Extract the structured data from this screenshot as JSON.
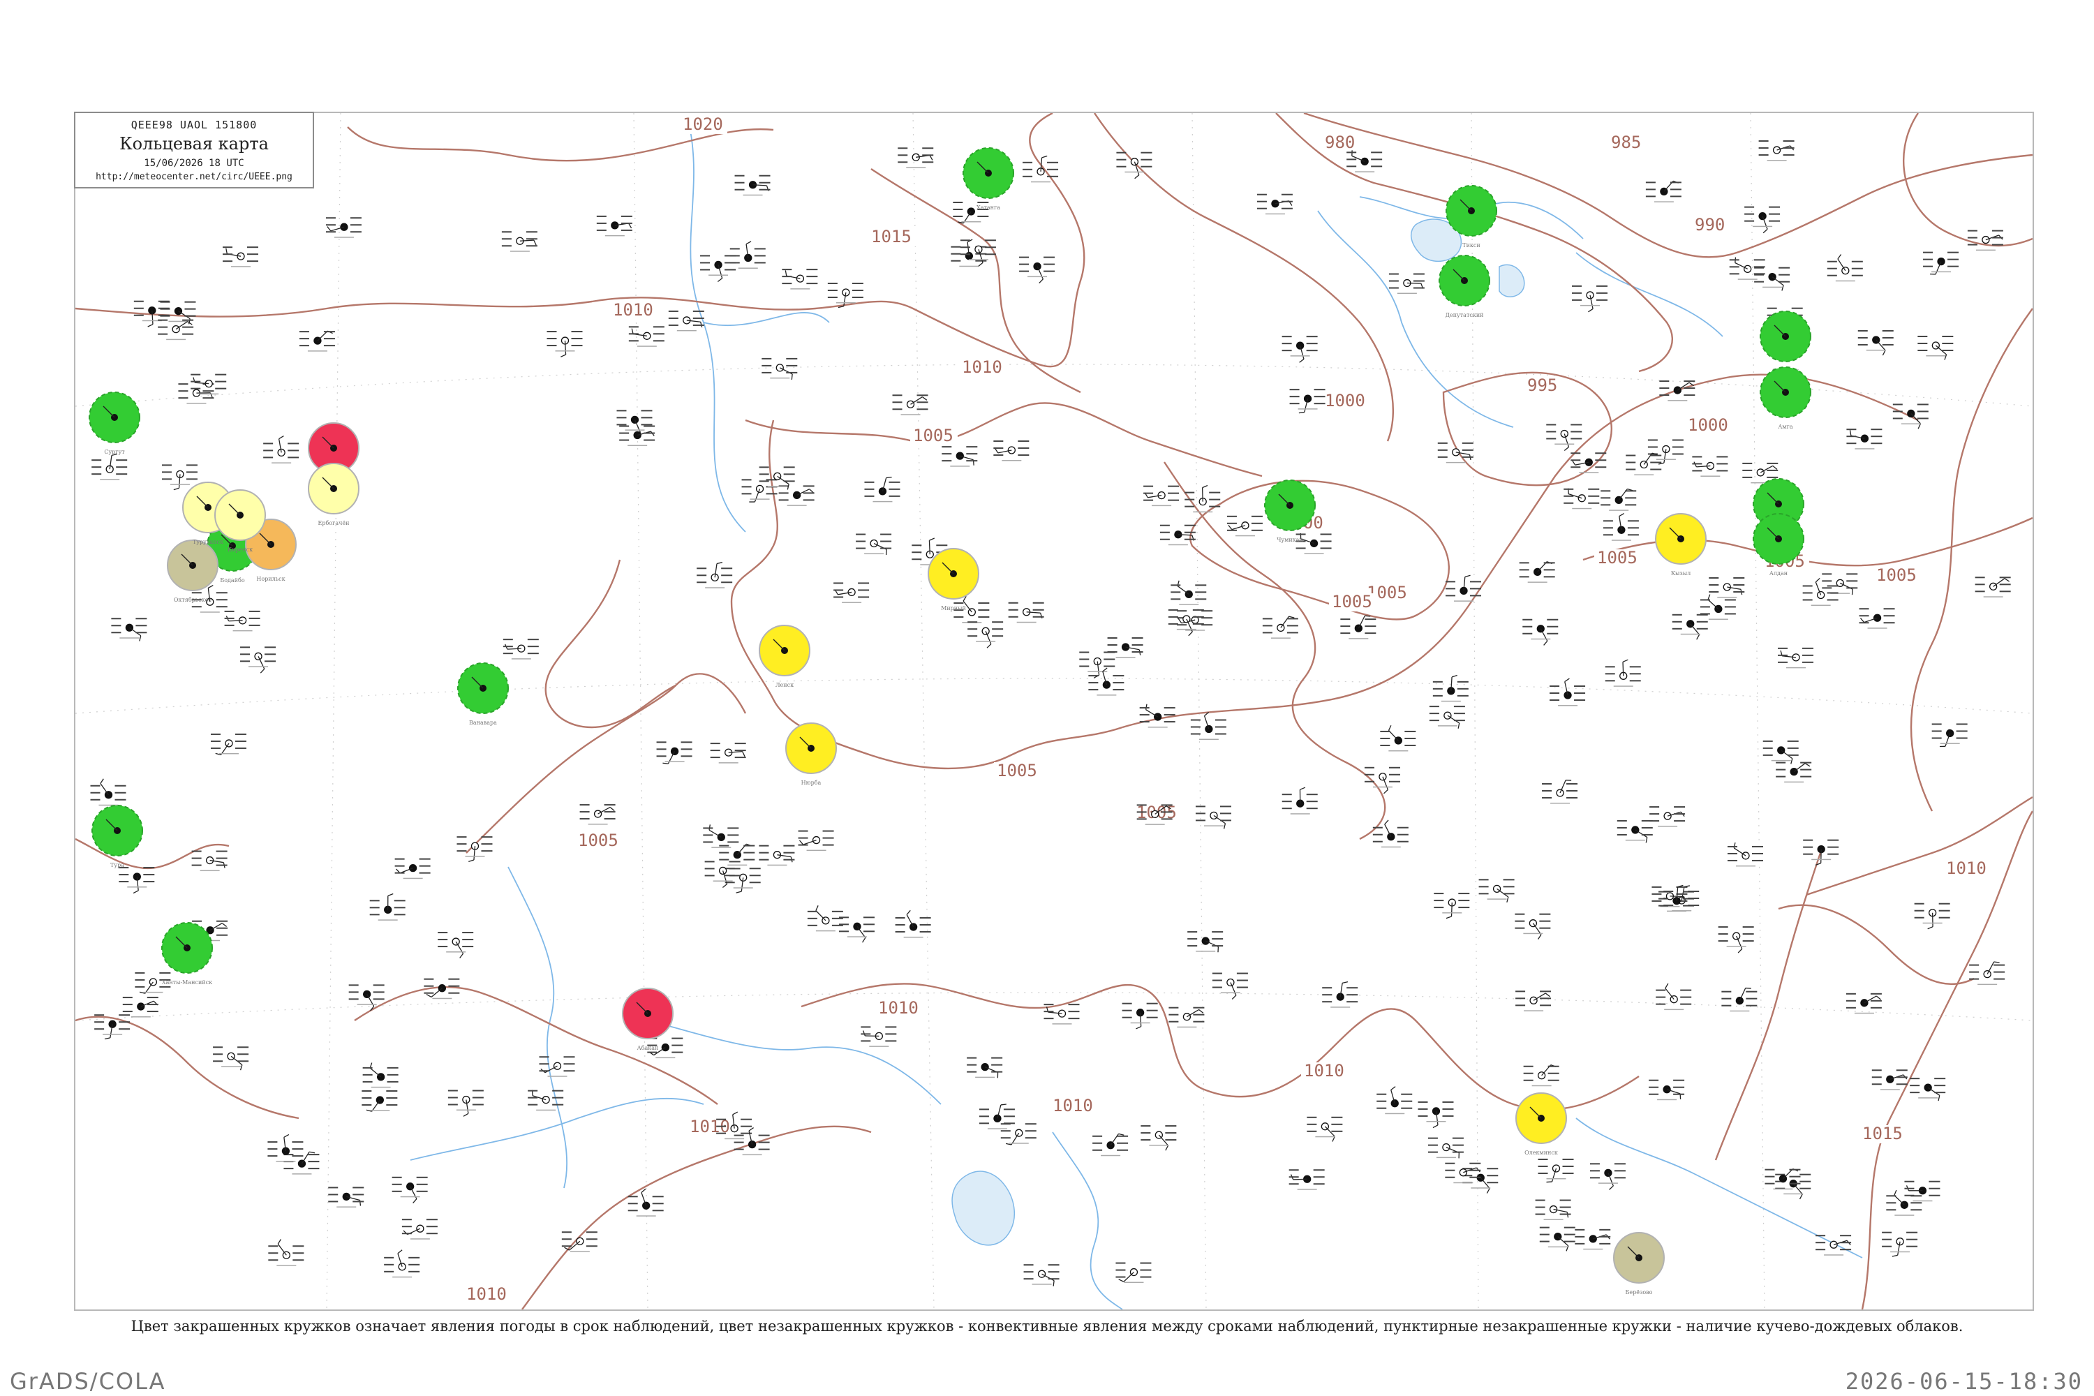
{
  "map_header": {
    "code": "QEEE98  UAOL  151800",
    "title": "Кольцевая карта",
    "datetime": "15/06/2026 18 UTC",
    "url": "http://meteocenter.net/circ/UEEE.png"
  },
  "isobar_labels": [
    {
      "text": "1020"
    },
    {
      "text": "1015"
    },
    {
      "text": "1010"
    },
    {
      "text": "1010"
    },
    {
      "text": "1005"
    },
    {
      "text": "1005"
    },
    {
      "text": "1005"
    },
    {
      "text": "1005"
    },
    {
      "text": "1005"
    },
    {
      "text": "1005"
    },
    {
      "text": "1000"
    },
    {
      "text": "1000"
    },
    {
      "text": "1000"
    },
    {
      "text": "995"
    },
    {
      "text": "990"
    },
    {
      "text": "985"
    },
    {
      "text": "980"
    },
    {
      "text": "1005"
    },
    {
      "text": "1010"
    },
    {
      "text": "1010"
    },
    {
      "text": "1010"
    },
    {
      "text": "1010"
    },
    {
      "text": "1015"
    },
    {
      "text": "1010"
    },
    {
      "text": "1010"
    },
    {
      "text": "1005"
    },
    {
      "text": "1005"
    }
  ],
  "marked_stations": [
    {
      "color": "#33cc33",
      "dashed": true,
      "label": "Хатанга"
    },
    {
      "color": "#33cc33",
      "dashed": true,
      "label": "Тикси"
    },
    {
      "color": "#33cc33",
      "dashed": true,
      "label": "Депутатский"
    },
    {
      "color": "#33cc33",
      "dashed": true,
      "label": "Оймякон"
    },
    {
      "color": "#33cc33",
      "dashed": true,
      "label": "Амга"
    },
    {
      "color": "#33cc33",
      "dashed": true,
      "label": "Якутск"
    },
    {
      "color": "#33cc33",
      "dashed": true,
      "label": "Алдан"
    },
    {
      "color": "#33cc33",
      "dashed": true,
      "label": "Чумикан"
    },
    {
      "color": "#33cc33",
      "dashed": true,
      "label": "Бодайбо"
    },
    {
      "color": "#33cc33",
      "dashed": true,
      "label": "Ванавара"
    },
    {
      "color": "#33cc33",
      "dashed": true,
      "label": "Тура"
    },
    {
      "color": "#33cc33",
      "dashed": true,
      "label": "Ханты-Мансийск"
    },
    {
      "color": "#33cc33",
      "dashed": true,
      "label": "Сургут"
    },
    {
      "color": "#ee3355",
      "dashed": false,
      "label": "Тобольск"
    },
    {
      "color": "#ee3355",
      "dashed": false,
      "label": "Абакан"
    },
    {
      "color": "#ffee22",
      "dashed": false,
      "label": "Мирный"
    },
    {
      "color": "#ffee22",
      "dashed": false,
      "label": "Нюрба"
    },
    {
      "color": "#ffee22",
      "dashed": false,
      "label": "Ленск"
    },
    {
      "color": "#ffee22",
      "dashed": false,
      "label": "Кызыл"
    },
    {
      "color": "#ffee22",
      "dashed": false,
      "label": "Олекминск"
    },
    {
      "color": "#c8c49a",
      "dashed": false,
      "label": "Берёзово"
    },
    {
      "color": "#c8c49a",
      "dashed": false,
      "label": "Октябрьское"
    },
    {
      "color": "#f5b85a",
      "dashed": false,
      "label": "Норильск"
    },
    {
      "color": "#ffffaa",
      "dashed": false,
      "label": "Туруханск"
    },
    {
      "color": "#ffffaa",
      "dashed": false,
      "label": "Ербогачён"
    },
    {
      "color": "#ffffaa",
      "dashed": false,
      "label": "Киренск"
    }
  ],
  "caption": "Цвет закрашенных кружков означает явления погоды в срок наблюдений, цвет незакрашенных кружков - конвективные явления между сроками наблюдений, пунктирные незакрашенные кружки - наличие кучево-дождевых облаков.",
  "footer": {
    "left": "GrADS/COLA",
    "right": "2026-06-15-18:30"
  }
}
